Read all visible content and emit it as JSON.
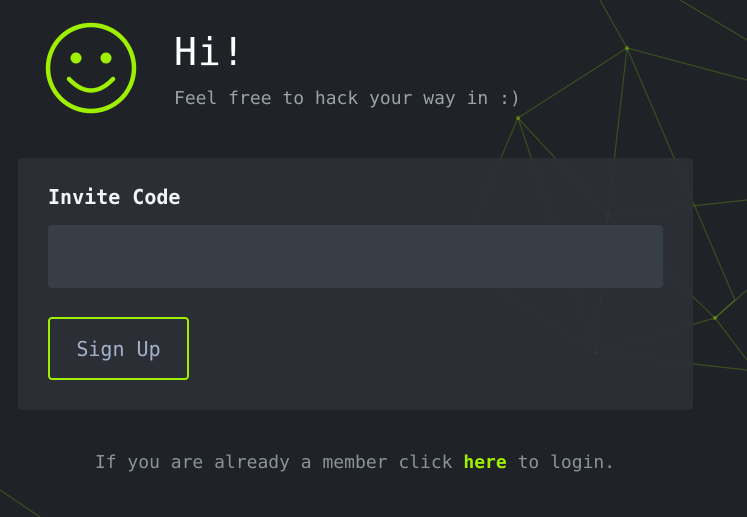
{
  "header": {
    "title": "Hi!",
    "subtitle": "Feel free to hack your way in :)"
  },
  "form": {
    "invite_label": "Invite Code",
    "invite_value": "",
    "signup_label": "Sign Up"
  },
  "footer": {
    "prefix": "If you are already a member click",
    "link_text": "here",
    "suffix": "to login."
  },
  "colors": {
    "accent": "#9fef00",
    "background": "#1f2227",
    "card": "#2c3035",
    "input": "#383e46"
  },
  "icons": {
    "hero": "smiley-face-icon"
  }
}
